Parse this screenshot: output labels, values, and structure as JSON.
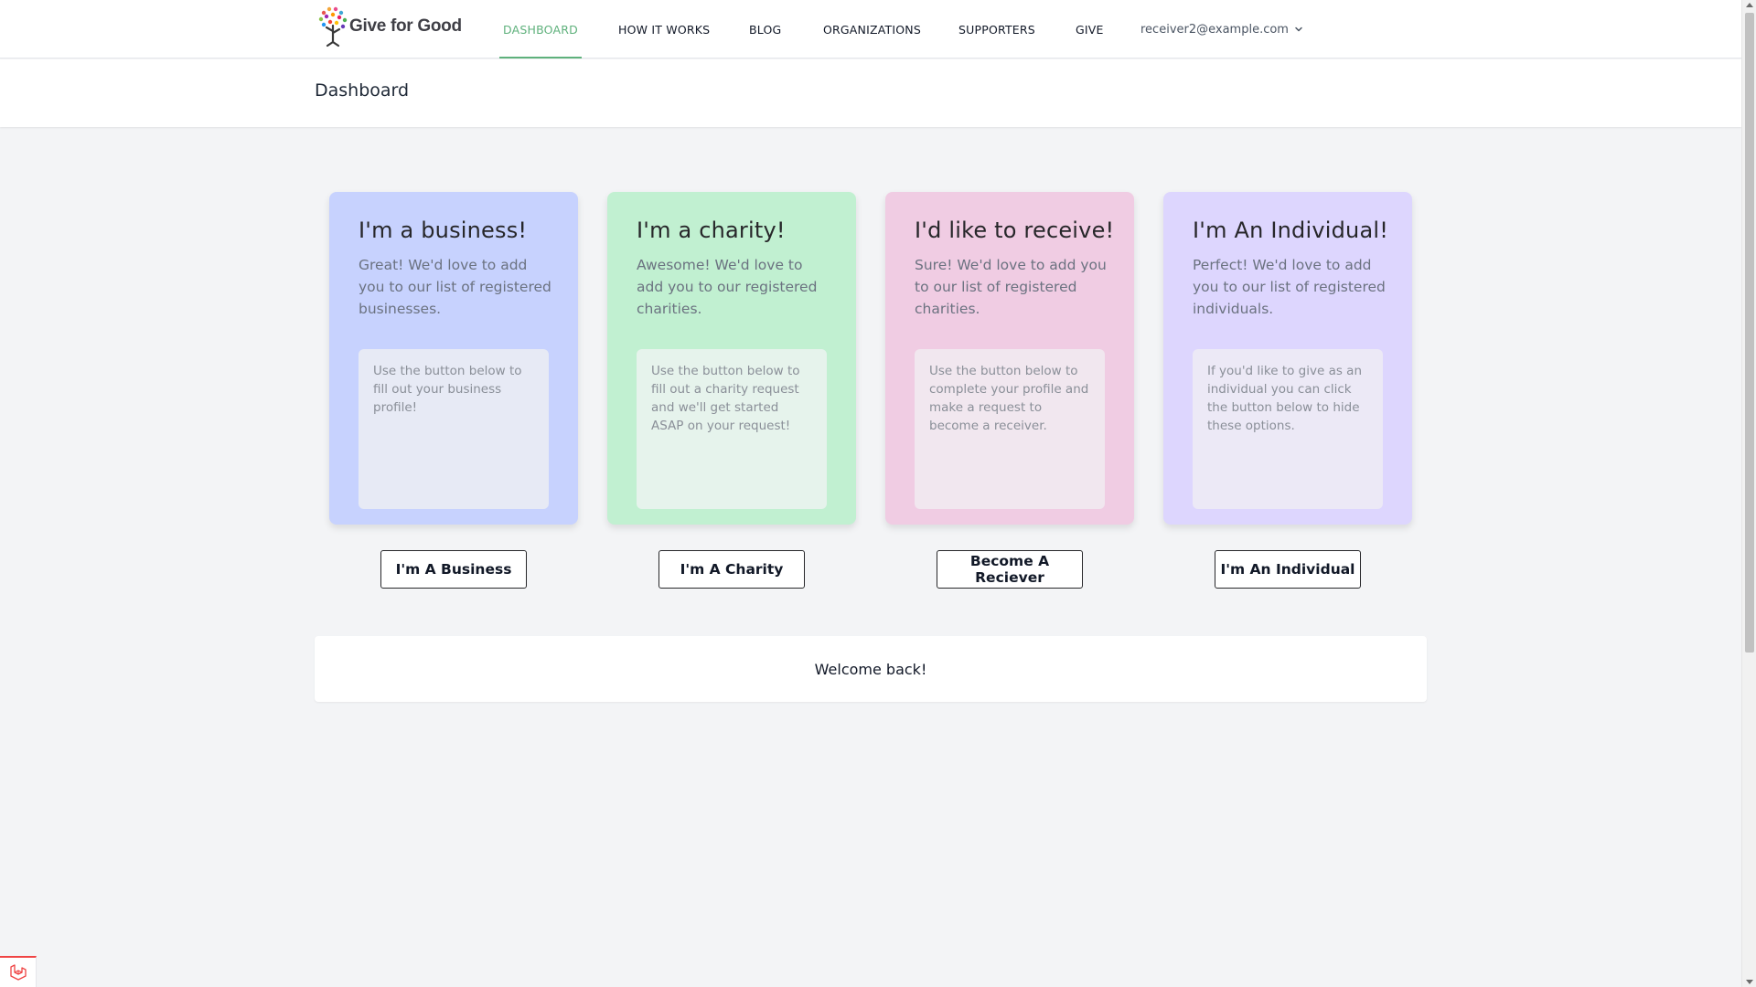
{
  "brand": {
    "name": "Give for Good"
  },
  "nav": {
    "items": [
      {
        "label": "DASHBOARD",
        "active": true
      },
      {
        "label": "HOW IT WORKS",
        "active": false
      },
      {
        "label": "BLOG",
        "active": false
      },
      {
        "label": "ORGANIZATIONS",
        "active": false
      },
      {
        "label": "SUPPORTERS",
        "active": false
      },
      {
        "label": "GIVE",
        "active": false
      }
    ],
    "user_email": "receiver2@example.com"
  },
  "header": {
    "title": "Dashboard"
  },
  "cards": [
    {
      "title": "I'm a business!",
      "description": "Great! We'd love to add you to our list of registered businesses.",
      "note": "Use the button below to fill out your business profile!",
      "button": "I'm A Business",
      "bg": "#c7d2fe",
      "inner_bg": "#e7eaf5"
    },
    {
      "title": "I'm a charity!",
      "description": "Awesome! We'd love to add you to our registered charities.",
      "note": "Use the button below to fill out a charity request and we'll get started ASAP on your request!",
      "button": "I'm A Charity",
      "bg": "#c1f0d1",
      "inner_bg": "#e6f3ec"
    },
    {
      "title": "I'd like to receive!",
      "description": "Sure! We'd love to add you to our list of registered charities.",
      "note": "Use the button below to complete your profile and make a request to become a receiver.",
      "button": "Become A Reciever",
      "bg": "#f0cce3",
      "inner_bg": "#f1e7ef"
    },
    {
      "title": "I'm An Individual!",
      "description": "Perfect! We'd love to add you to our list of registered individuals.",
      "note": "If you'd like to give as an individual you can click the button below to hide these options.",
      "button": "I'm An Individual",
      "bg": "#ddd6fe",
      "inner_bg": "#ece9f6"
    }
  ],
  "welcome": {
    "message": "Welcome back!"
  },
  "colors": {
    "accent": "#5fb17c",
    "background": "#f3f4f6"
  },
  "icons": {
    "user_menu": "chevron-down-icon",
    "debug": "laravel-icon"
  }
}
